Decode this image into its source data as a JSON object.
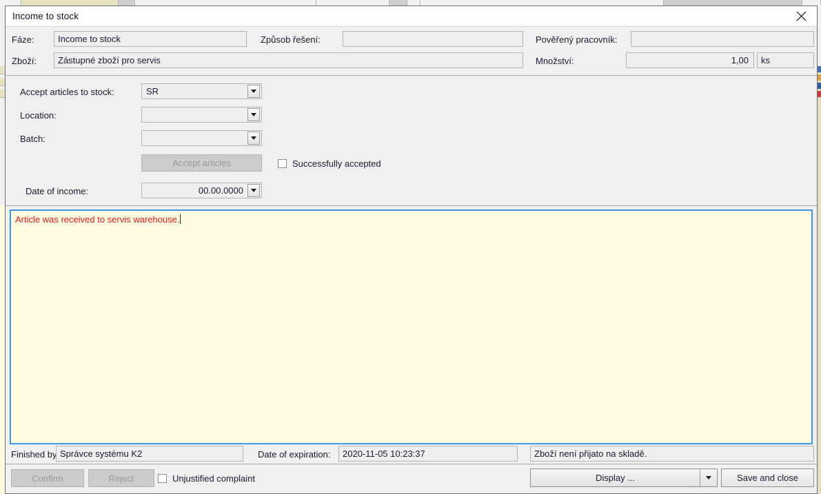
{
  "window": {
    "title": "Income to stock",
    "close_icon": "close-icon"
  },
  "header": {
    "phase_label": "Fáze:",
    "phase_value": "Income to stock",
    "solution_label": "Způsob řešení:",
    "solution_value": "",
    "worker_label": "Pověřený pracovník:",
    "worker_value": "",
    "goods_label": "Zboží:",
    "goods_value": "Zástupné zboží pro servis",
    "quantity_label": "Množství:",
    "quantity_value": "1,00",
    "unit_value": "ks"
  },
  "form": {
    "accept_to_stock_label": "Accept articles to stock:",
    "accept_to_stock_value": "SR",
    "location_label": "Location:",
    "location_value": "",
    "batch_label": "Batch:",
    "batch_value": "",
    "accept_button_label": "Accept articles",
    "successfully_accepted_label": "Successfully accepted",
    "successfully_accepted_checked": false,
    "date_of_income_label": "Date of income:",
    "date_of_income_value": "00.00.0000",
    "dropdown_icon": "chevron-down-icon"
  },
  "memo": {
    "text": "Article was received to servis warehouse.",
    "text_color": "#ee1c1c",
    "background_color": "#fdfce0",
    "focus_border_color": "#3d9ae0"
  },
  "status": {
    "finished_by_label": "Finished by",
    "finished_by_value": "Správce systému K2",
    "expiration_label": "Date of expiration:",
    "expiration_value": "2020-11-05 10:23:37",
    "message_value": "Zboží není přijato na skladě."
  },
  "commands": {
    "confirm_label": "Confirm",
    "confirm_enabled": false,
    "reject_label": "Reject",
    "reject_enabled": false,
    "unjustified_label": "Unjustified complaint",
    "unjustified_checked": false,
    "display_label": "Display ...",
    "display_arrow_icon": "chevron-down-icon",
    "save_close_label": "Save and close"
  }
}
